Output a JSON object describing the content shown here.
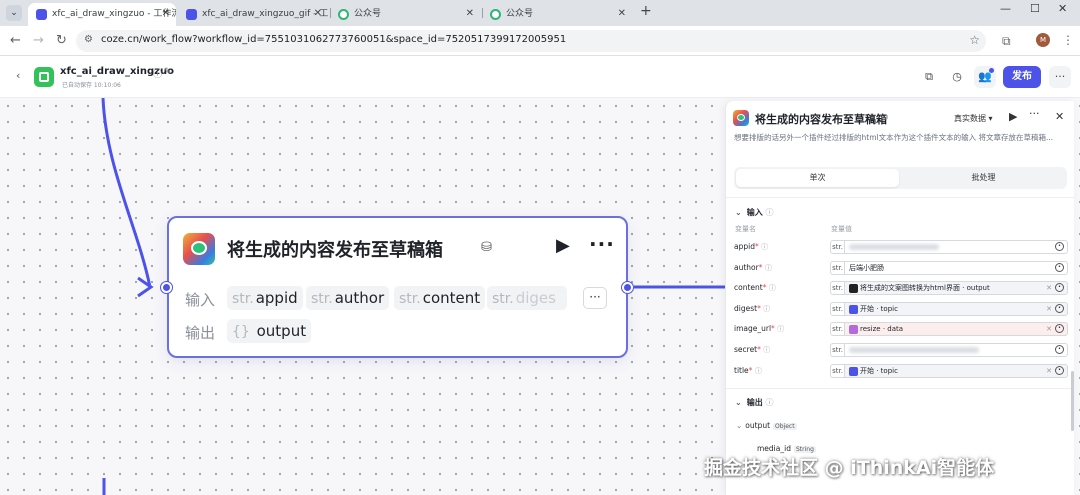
{
  "browser": {
    "tabs": [
      {
        "title": "xfc_ai_draw_xingzuo - 工作流",
        "favicon": "coze-icon",
        "active": true
      },
      {
        "title": "xfc_ai_draw_xingzuo_gif - 工作",
        "favicon": "coze-icon",
        "active": false
      },
      {
        "title": "公众号",
        "favicon": "wechat-official-icon",
        "active": false
      },
      {
        "title": "公众号",
        "favicon": "wechat-official-icon",
        "active": false
      }
    ],
    "url": "coze.cn/work_flow?workflow_id=7551031062773760051&space_id=7520517399172005951",
    "profile_initial": "M"
  },
  "header": {
    "workflow_name": "xfc_ai_draw_xingzuo",
    "autosave": "已自动保存 10:10:06",
    "publish_label": "发布"
  },
  "node": {
    "title": "将生成的内容发布至草稿箱",
    "input_label": "输入",
    "output_label": "输出",
    "input_type_prefix": "str.",
    "inputs": [
      "appid",
      "author",
      "content",
      "diges"
    ],
    "output_type_prefix": "{}",
    "output": "output"
  },
  "panel": {
    "title": "将生成的内容发布至草稿箱",
    "mode": "真实数据",
    "description": "想要排版的话另外一个插件经过排版的html文本作为这个插件文本的输入 将文章存放在草稿箱...",
    "tabs": {
      "single": "单次",
      "batch": "批处理"
    },
    "input_section": "输入",
    "col_name": "变量名",
    "col_value": "变量值",
    "type_prefix": "str.",
    "params": [
      {
        "name": "appid",
        "value": ""
      },
      {
        "name": "author",
        "value": "后端小肥肠"
      },
      {
        "name": "content",
        "value": "将生成的文案图转换为html界面 · output"
      },
      {
        "name": "digest",
        "value": "开始 · topic"
      },
      {
        "name": "image_url",
        "value": "resize · data"
      },
      {
        "name": "secret",
        "value": ""
      },
      {
        "name": "title",
        "value": "开始 · topic"
      }
    ],
    "output_section": "输出",
    "output_name": "output",
    "output_type": "Object",
    "output_child": "media_id",
    "output_child_type": "String"
  },
  "watermark": "掘金技术社区 @ iThinkAi智能体",
  "colors": {
    "accent": "#4d53e8",
    "edge": "#4d53e8",
    "canvas": "#f7f7fa"
  }
}
